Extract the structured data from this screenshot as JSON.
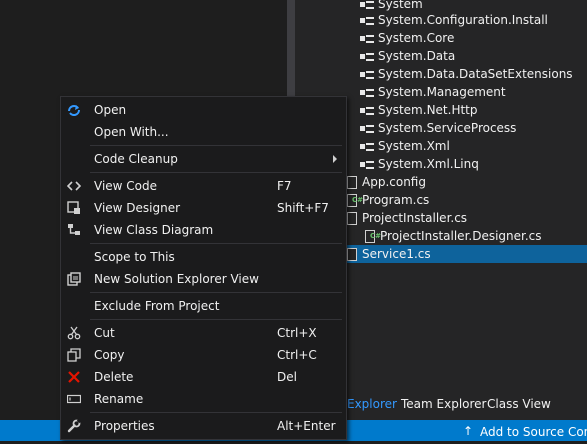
{
  "solution_explorer": {
    "references": [
      "System",
      "System.Configuration.Install",
      "System.Core",
      "System.Data",
      "System.Data.DataSetExtensions",
      "System.Management",
      "System.Net.Http",
      "System.ServiceProcess",
      "System.Xml",
      "System.Xml.Linq"
    ],
    "files": [
      "App.config",
      "Program.cs",
      "ProjectInstaller.cs",
      "ProjectInstaller.Designer.cs",
      "Service1.cs"
    ],
    "tabs": [
      "Explorer",
      "Team Explorer",
      "Class View"
    ]
  },
  "status_bar": {
    "source_control": "Add to Source Control"
  },
  "context_menu": {
    "open": "Open",
    "open_with": "Open With...",
    "code_cleanup": "Code Cleanup",
    "view_code": "View Code",
    "view_code_shortcut": "F7",
    "view_designer": "View Designer",
    "view_designer_shortcut": "Shift+F7",
    "view_class_diagram": "View Class Diagram",
    "scope_to_this": "Scope to This",
    "new_solution_explorer_view": "New Solution Explorer View",
    "exclude_from_project": "Exclude From Project",
    "cut": "Cut",
    "cut_shortcut": "Ctrl+X",
    "copy": "Copy",
    "copy_shortcut": "Ctrl+C",
    "delete": "Delete",
    "delete_shortcut": "Del",
    "rename": "Rename",
    "properties": "Properties",
    "properties_shortcut": "Alt+Enter"
  },
  "colors": {
    "accent": "#007acc",
    "selection": "#0e639c",
    "menu_bg": "#1b1b1c",
    "delete_icon": "#e51400"
  }
}
